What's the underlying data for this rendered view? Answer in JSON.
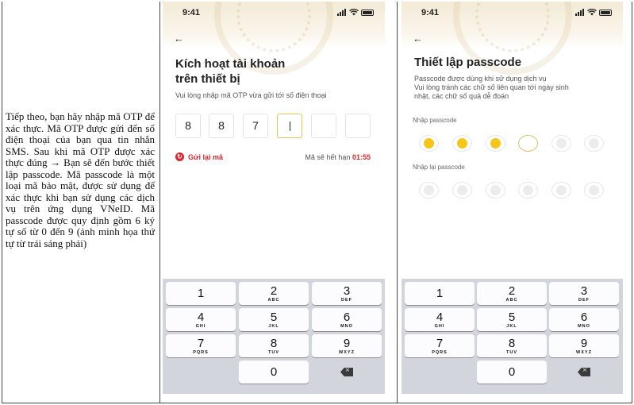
{
  "instruction_text": "Tiếp theo, bạn hãy nhập mã OTP để xác thực. Mã OTP được gửi đến số điện thoại của bạn qua tin nhắn SMS. Sau khi mã OTP được xác thực đúng → Bạn sẽ đến bước thiết lập passcode. Mã passcode là một loại mã bảo mật, được sử dụng để xác thực khi bạn sử dụng các dịch vụ trên ứng dụng VNeID. Mã passcode được quy định gồm 6 ký tự số từ 0 đến 9 (ảnh minh họa thứ tự từ trái sáng phải)",
  "screen_otp": {
    "status_time": "9:41",
    "back_glyph": "←",
    "title_line1": "Kích hoạt tài khoản",
    "title_line2": "trên thiết bị",
    "subtitle": "Vui lòng nhập mã OTP vừa gửi tới số điện thoại",
    "otp_digits": [
      "8",
      "8",
      "7",
      "",
      "",
      ""
    ],
    "otp_active_index": 3,
    "resend_icon": "refresh-icon",
    "resend_label": "Gửi lại mã",
    "expire_label": "Mã sẽ hết hạn",
    "expire_time": "01:55"
  },
  "screen_passcode": {
    "status_time": "9:41",
    "back_glyph": "←",
    "title": "Thiết lập passcode",
    "desc_line1": "Passcode được dùng khi sử dụng dịch vụ",
    "desc_line2": "Vui lòng tránh các chữ số liên quan tới ngày sinh",
    "desc_line3": "nhật, các chữ số quá dễ đoán",
    "enter_label": "Nhập passcode",
    "reenter_label": "Nhập lại passcode",
    "entered_count": 3,
    "total_digits": 6
  },
  "keypad": {
    "keys": [
      {
        "num": "1",
        "letters": ""
      },
      {
        "num": "2",
        "letters": "ABC"
      },
      {
        "num": "3",
        "letters": "DEF"
      },
      {
        "num": "4",
        "letters": "GHI"
      },
      {
        "num": "5",
        "letters": "JKL"
      },
      {
        "num": "6",
        "letters": "MNO"
      },
      {
        "num": "7",
        "letters": "PQRS"
      },
      {
        "num": "8",
        "letters": "TUV"
      },
      {
        "num": "9",
        "letters": "WXYZ"
      },
      {
        "num": "0",
        "letters": ""
      }
    ],
    "delete_icon": "backspace-icon"
  },
  "colors": {
    "accent_yellow": "#f5c518",
    "accent_red": "#d7282f",
    "keypad_bg": "#d2d5db"
  }
}
